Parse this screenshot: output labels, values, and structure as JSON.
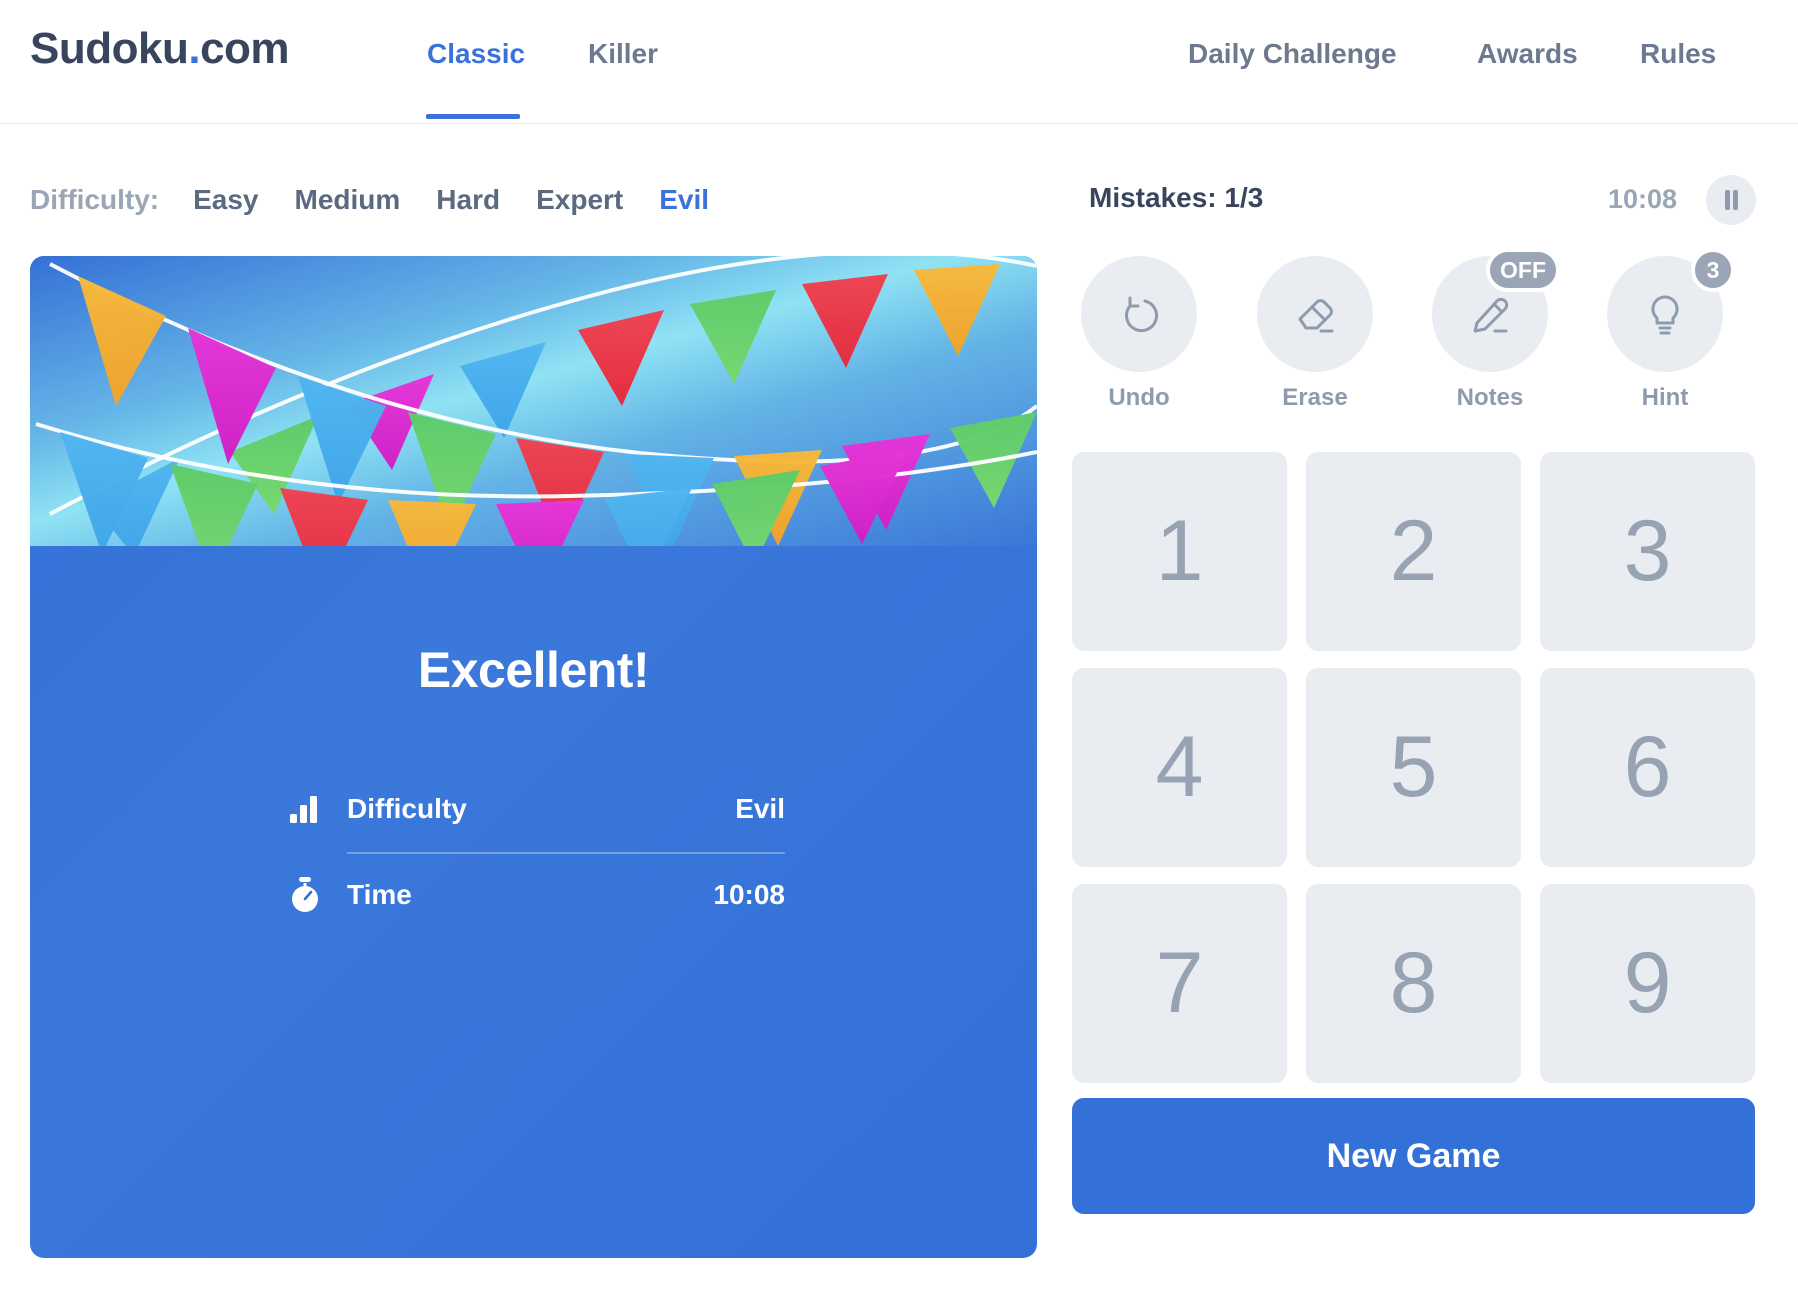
{
  "header": {
    "logo_main": "Sudoku",
    "logo_dot": ".",
    "logo_tld": "com",
    "tabs": [
      {
        "label": "Classic",
        "active": true
      },
      {
        "label": "Killer",
        "active": false
      }
    ],
    "nav": [
      {
        "label": "Daily Challenge"
      },
      {
        "label": "Awards"
      },
      {
        "label": "Rules"
      }
    ]
  },
  "difficulty_bar": {
    "label": "Difficulty:",
    "options": [
      "Easy",
      "Medium",
      "Hard",
      "Expert",
      "Evil"
    ],
    "selected": "Evil"
  },
  "status": {
    "mistakes": "Mistakes: 1/3",
    "timer": "10:08",
    "pause_icon": "pause-icon"
  },
  "win_panel": {
    "title": "Excellent!",
    "stats": [
      {
        "icon": "bar-chart-icon",
        "name": "Difficulty",
        "value": "Evil"
      },
      {
        "icon": "stopwatch-icon",
        "name": "Time",
        "value": "10:08"
      }
    ]
  },
  "tools": [
    {
      "id": "undo",
      "label": "Undo",
      "icon": "undo-icon",
      "badge": null
    },
    {
      "id": "erase",
      "label": "Erase",
      "icon": "eraser-icon",
      "badge": null
    },
    {
      "id": "notes",
      "label": "Notes",
      "icon": "pencil-icon",
      "badge": "OFF"
    },
    {
      "id": "hint",
      "label": "Hint",
      "icon": "lightbulb-icon",
      "badge": "3"
    }
  ],
  "numpad": {
    "keys": [
      "1",
      "2",
      "3",
      "4",
      "5",
      "6",
      "7",
      "8",
      "9"
    ]
  },
  "new_game": {
    "label": "New Game"
  },
  "colors": {
    "brand_blue": "#3b72d9",
    "panel_blue": "#3370d8",
    "text_dark": "#39455c",
    "text_muted": "#6d798e",
    "key_bg": "#e9edf2",
    "badge_gray": "#9aa5b5"
  }
}
